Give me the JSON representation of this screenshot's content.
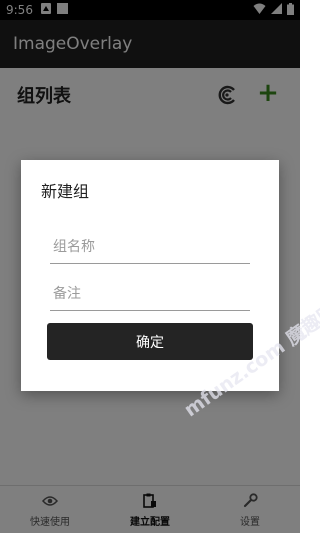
{
  "status_bar": {
    "time": "9:56"
  },
  "app_bar": {
    "title": "ImageOverlay"
  },
  "content": {
    "list_title": "组列表"
  },
  "bottom_nav": {
    "items": [
      {
        "label": "快速使用",
        "icon": "eye-icon"
      },
      {
        "label": "建立配置",
        "icon": "clipboard-icon",
        "active": true
      },
      {
        "label": "设置",
        "icon": "wrench-icon"
      }
    ]
  },
  "dialog": {
    "title": "新建组",
    "name_placeholder": "组名称",
    "note_placeholder": "备注",
    "confirm_label": "确定"
  },
  "watermark": {
    "text": "mfunz.com 魔趣网"
  },
  "colors": {
    "accent_green": "#3a8a1f",
    "app_bar": "#212121",
    "button_dark": "#242424"
  }
}
